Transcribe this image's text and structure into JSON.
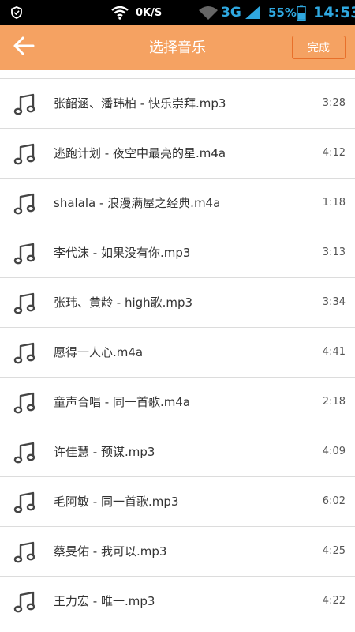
{
  "status_bar": {
    "net_speed": "0K/S",
    "network": "3G",
    "battery": "55%",
    "time": "14:53"
  },
  "header": {
    "title": "选择音乐",
    "done_label": "完成",
    "back_icon": "arrow-left-icon"
  },
  "songs": [
    {
      "name": "张韶涵、潘玮柏 - 快乐崇拜.mp3",
      "duration": "3:28"
    },
    {
      "name": "逃跑计划 - 夜空中最亮的星.m4a",
      "duration": "4:12"
    },
    {
      "name": "shalala - 浪漫满屋之经典.m4a",
      "duration": "1:18"
    },
    {
      "name": "李代沫 - 如果没有你.mp3",
      "duration": "3:13"
    },
    {
      "name": "张玮、黄龄 - high歌.mp3",
      "duration": "3:34"
    },
    {
      "name": "愿得一人心.m4a",
      "duration": "4:41"
    },
    {
      "name": "童声合唱 - 同一首歌.m4a",
      "duration": "2:18"
    },
    {
      "name": "许佳慧 - 预谋.mp3",
      "duration": "4:09"
    },
    {
      "name": "毛阿敏 - 同一首歌.mp3",
      "duration": "6:02"
    },
    {
      "name": "蔡旻佑 - 我可以.mp3",
      "duration": "4:25"
    },
    {
      "name": "王力宏 - 唯一.mp3",
      "duration": "4:22"
    }
  ],
  "colors": {
    "header_bg": "#f5a262",
    "accent": "#2fa8e0"
  }
}
